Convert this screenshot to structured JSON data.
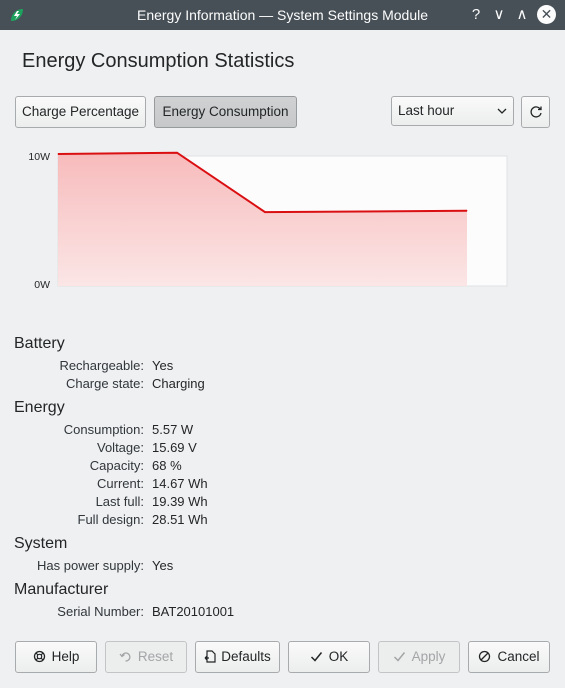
{
  "window": {
    "title": "Energy Information — System Settings Module",
    "icons": {
      "app": "battery-leaf-icon",
      "help": "help-icon",
      "minimize": "minimize-icon",
      "maximize": "maximize-icon",
      "close": "close-icon"
    },
    "help_glyph": "?",
    "minimize_glyph": "∨",
    "maximize_glyph": "∧",
    "close_glyph": "✕"
  },
  "header": {
    "title": "Energy Consumption Statistics"
  },
  "tabs": {
    "charge_percentage": "Charge Percentage",
    "energy_consumption": "Energy Consumption",
    "active": "energy_consumption"
  },
  "history_range": {
    "selected": "Last hour",
    "chevron": "⌄"
  },
  "refresh": {
    "icon": "refresh-icon",
    "glyph": "↻"
  },
  "chart_data": {
    "type": "area",
    "ylim": [
      0,
      10
    ],
    "y_ticks": [
      "10W",
      "0W"
    ],
    "x": [
      0,
      1,
      2,
      3
    ],
    "values": [
      10.0,
      10.1,
      5.6,
      5.7
    ],
    "line_color": "#da0f12",
    "fill_color": "#f7b7b8",
    "grid": false
  },
  "battery": {
    "heading": "Battery",
    "rows": [
      {
        "label": "Rechargeable:",
        "value": "Yes"
      },
      {
        "label": "Charge state:",
        "value": "Charging"
      }
    ]
  },
  "energy": {
    "heading": "Energy",
    "rows": [
      {
        "label": "Consumption:",
        "value": "5.57 W"
      },
      {
        "label": "Voltage:",
        "value": "15.69 V"
      },
      {
        "label": "Capacity:",
        "value": "68 %"
      },
      {
        "label": "Current:",
        "value": "14.67 Wh"
      },
      {
        "label": "Last full:",
        "value": "19.39 Wh"
      },
      {
        "label": "Full design:",
        "value": "28.51 Wh"
      }
    ]
  },
  "system": {
    "heading": "System",
    "rows": [
      {
        "label": "Has power supply:",
        "value": "Yes"
      }
    ]
  },
  "manufacturer": {
    "heading": "Manufacturer",
    "rows": [
      {
        "label": "Serial Number:",
        "value": "BAT20101001"
      }
    ]
  },
  "buttons": {
    "help": {
      "label": "Help",
      "icon": "help-lifebuoy-icon",
      "glyph": "⚙"
    },
    "reset": {
      "label": "Reset",
      "icon": "undo-icon",
      "glyph": "↶"
    },
    "defaults": {
      "label": "Defaults",
      "icon": "document-revert-icon",
      "glyph": "⎘"
    },
    "ok": {
      "label": "OK",
      "icon": "checkmark-icon",
      "glyph": "✓"
    },
    "apply": {
      "label": "Apply",
      "icon": "checkmark-icon",
      "glyph": "✓"
    },
    "cancel": {
      "label": "Cancel",
      "icon": "cancel-icon",
      "glyph": "⊘"
    }
  }
}
